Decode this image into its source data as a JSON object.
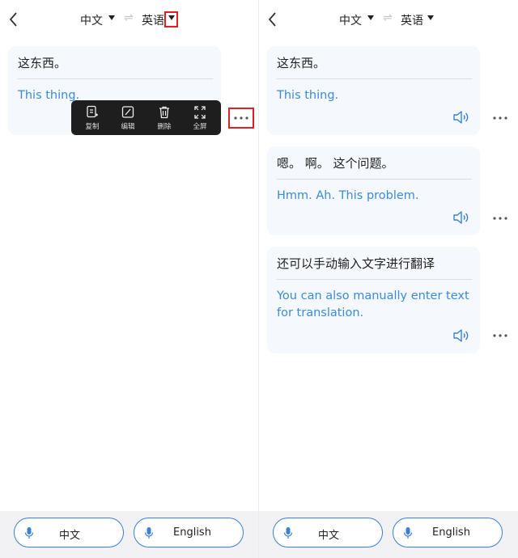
{
  "left": {
    "header": {
      "source_lang": "中文",
      "swap": "⇌",
      "target_lang": "英语"
    },
    "card": {
      "zh": "这东西。",
      "en": "This thing."
    },
    "toolbar": {
      "copy": "复制",
      "edit": "编辑",
      "delete": "删除",
      "fullscreen": "全屏"
    },
    "bottom": {
      "left_button": "中文",
      "right_button": "English"
    }
  },
  "right": {
    "header": {
      "source_lang": "中文",
      "swap": "⇌",
      "target_lang": "英语"
    },
    "cards": [
      {
        "zh": "这东西。",
        "en": "This thing."
      },
      {
        "zh": "嗯。 啊。 这个问题。",
        "en": "Hmm. Ah. This problem."
      },
      {
        "zh": "还可以手动输入文字进行翻译",
        "en": "You can also manually enter text for translation."
      }
    ],
    "bottom": {
      "left_button": "中文",
      "right_button": "English"
    }
  },
  "colors": {
    "accent": "#3a8bd8",
    "highlight": "#e02020",
    "card_bg": "#f5f8fd",
    "toolbar_bg": "#1e1e1e"
  }
}
